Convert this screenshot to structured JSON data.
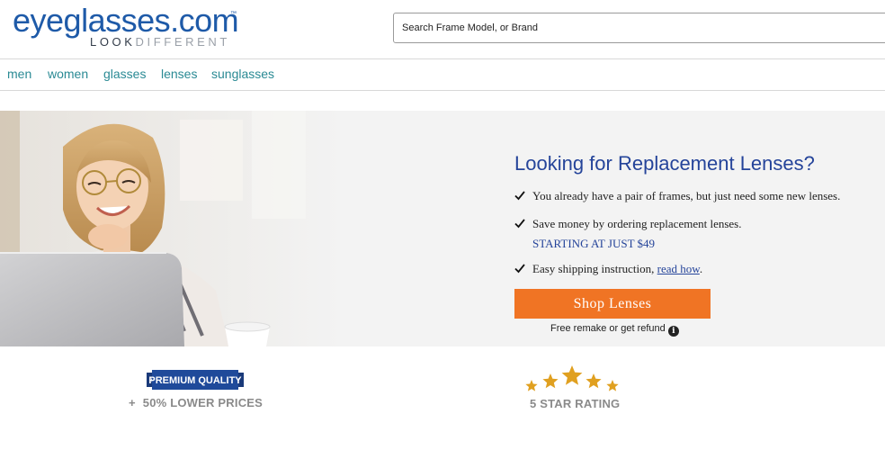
{
  "header": {
    "logo": {
      "main": "eyeglasses.com",
      "tm": "™",
      "tag_part1": "LOOK",
      "tag_part2": "DIFFERENT"
    },
    "search": {
      "placeholder": "Search Frame Model, or Brand",
      "value": ""
    }
  },
  "nav": {
    "items": [
      {
        "label": "men"
      },
      {
        "label": "women"
      },
      {
        "label": "glasses"
      },
      {
        "label": "lenses"
      },
      {
        "label": "sunglasses"
      }
    ]
  },
  "hero": {
    "title": "Looking for Replacement Lenses?",
    "bullets": [
      {
        "text": "You already have a pair of frames, but just need some new lenses."
      },
      {
        "text": "Save money by ordering replacement lenses.",
        "sub": "STARTING AT JUST $49"
      },
      {
        "text": "Easy shipping instruction, ",
        "link": "read how",
        "suffix": "."
      }
    ],
    "cta": "Shop Lenses",
    "refund": "Free remake or get refund",
    "info_glyph": "i"
  },
  "badges": {
    "quality": {
      "ribbon": "PREMIUM QUALITY",
      "plus": "+",
      "text": "50% LOWER PRICES"
    },
    "rating": {
      "stars": 5,
      "text": "5 STAR RATING"
    }
  },
  "colors": {
    "brand_blue": "#1e5aa8",
    "nav_teal": "#2a8a94",
    "title_blue": "#25449a",
    "cta_orange": "#f07424",
    "hero_bg": "#f3f3f3",
    "star_gold": "#e0a020"
  }
}
